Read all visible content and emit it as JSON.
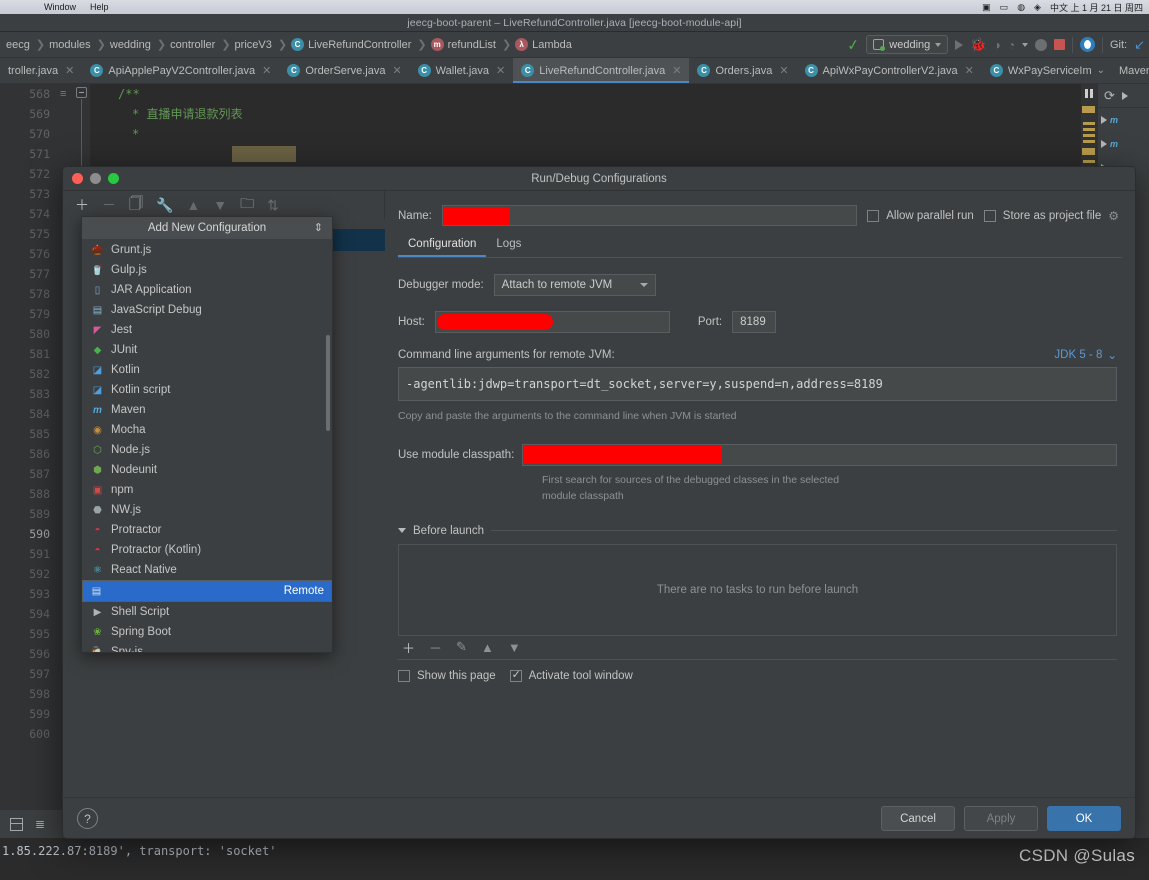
{
  "mac_menu": {
    "items": [
      "Window",
      "Help"
    ],
    "right_items": [
      "⌘",
      "▣",
      "◑",
      "☸",
      "♫",
      "◔",
      "⌫"
    ],
    "right_text": "中文 上 1 月 21 日 周四"
  },
  "ide": {
    "title": "jeecg-boot-parent – LiveRefundController.java [jeecg-boot-module-api]"
  },
  "breadcrumb": {
    "items": [
      {
        "label": "eecg",
        "badge": null
      },
      {
        "label": "modules",
        "badge": null
      },
      {
        "label": "wedding",
        "badge": null
      },
      {
        "label": "controller",
        "badge": null
      },
      {
        "label": "priceV3",
        "badge": null
      },
      {
        "label": "LiveRefundController",
        "badge": "C",
        "badge_kind": "c"
      },
      {
        "label": "refundList",
        "badge": "m",
        "badge_kind": "m"
      },
      {
        "label": "Lambda",
        "badge": "λ",
        "badge_kind": "l"
      }
    ]
  },
  "nav_toolbar": {
    "run_config": "wedding",
    "git_label": "Git:",
    "icons": [
      "checkmark-green-icon",
      "run-icon",
      "debug-icon",
      "coverage-icon",
      "profile-icon",
      "stop-icon",
      "idea-icon",
      "git-update-icon"
    ]
  },
  "editor_tabs": [
    {
      "label": "troller.java",
      "active": false
    },
    {
      "label": "ApiApplePayV2Controller.java",
      "active": false
    },
    {
      "label": "OrderServe.java",
      "active": false
    },
    {
      "label": "Wallet.java",
      "active": false
    },
    {
      "label": "LiveRefundController.java",
      "active": true
    },
    {
      "label": "Orders.java",
      "active": false
    },
    {
      "label": "ApiWxPayControllerV2.java",
      "active": false
    },
    {
      "label": "WxPayServiceIm",
      "active": false
    }
  ],
  "right_tool_label": "Maven",
  "editor": {
    "line_numbers": [
      "568",
      "569",
      "570",
      "571",
      "572",
      "573",
      "574",
      "575",
      "576",
      "577",
      "578",
      "579",
      "580",
      "581",
      "582",
      "583",
      "584",
      "585",
      "586",
      "587",
      "588",
      "589",
      "590",
      "591",
      "592",
      "593",
      "594",
      "595",
      "596",
      "597",
      "598",
      "599",
      "600"
    ],
    "current_line": "590",
    "code_lines": [
      "/**",
      "* 直播申请退款列表",
      "*"
    ]
  },
  "console": {
    "text": "1.85.222.87:8189', transport: 'socket'",
    "watermark": "CSDN @Sulas"
  },
  "dialog": {
    "title": "Run/Debug Configurations",
    "left_toolbar_icons": [
      "add-icon",
      "remove-icon",
      "copy-icon",
      "edit-templates-icon",
      "move-up-icon",
      "move-down-icon",
      "new-folder-icon",
      "sort-icon"
    ],
    "popup": {
      "header": "Add New Configuration",
      "items": [
        {
          "label": "Grunt.js",
          "icon": "grunt-icon"
        },
        {
          "label": "Gulp.js",
          "icon": "gulp-icon"
        },
        {
          "label": "JAR Application",
          "icon": "jar-icon"
        },
        {
          "label": "JavaScript Debug",
          "icon": "javascript-debug-icon"
        },
        {
          "label": "Jest",
          "icon": "jest-icon"
        },
        {
          "label": "JUnit",
          "icon": "junit-icon"
        },
        {
          "label": "Kotlin",
          "icon": "kotlin-icon"
        },
        {
          "label": "Kotlin script",
          "icon": "kotlin-script-icon"
        },
        {
          "label": "Maven",
          "icon": "maven-icon"
        },
        {
          "label": "Mocha",
          "icon": "mocha-icon"
        },
        {
          "label": "Node.js",
          "icon": "nodejs-icon"
        },
        {
          "label": "Nodeunit",
          "icon": "nodeunit-icon"
        },
        {
          "label": "npm",
          "icon": "npm-icon"
        },
        {
          "label": "NW.js",
          "icon": "nwjs-icon"
        },
        {
          "label": "Protractor",
          "icon": "protractor-icon"
        },
        {
          "label": "Protractor (Kotlin)",
          "icon": "protractor-kotlin-icon"
        },
        {
          "label": "React Native",
          "icon": "react-native-icon"
        },
        {
          "label": "Remote",
          "icon": "remote-icon",
          "selected": true
        },
        {
          "label": "Shell Script",
          "icon": "shell-script-icon"
        },
        {
          "label": "Spring Boot",
          "icon": "spring-boot-icon"
        },
        {
          "label": "Spy-js",
          "icon": "spy-js-icon"
        }
      ]
    },
    "name_label": "Name:",
    "name_value": "",
    "allow_parallel_run": "Allow parallel run",
    "store_as_project_file": "Store as project file",
    "tabs": [
      {
        "label": "Configuration",
        "active": true
      },
      {
        "label": "Logs",
        "active": false
      }
    ],
    "debugger_mode_label": "Debugger mode:",
    "debugger_mode_value": "Attach to remote JVM",
    "host_label": "Host:",
    "host_value": "",
    "port_label": "Port:",
    "port_value": "8189",
    "args_label": "Command line arguments for remote JVM:",
    "jdk_label": "JDK 5 - 8",
    "args_value": "-agentlib:jdwp=transport=dt_socket,server=y,suspend=n,address=8189",
    "args_hint": "Copy and paste the arguments to the command line when JVM is started",
    "module_classpath_label": "Use module classpath:",
    "module_classpath_value": "",
    "module_hint_line1": "First search for sources of the debugged classes in the selected",
    "module_hint_line2": "module classpath",
    "before_launch_label": "Before launch",
    "before_launch_empty": "There are no tasks to run before launch",
    "before_launch_toolbar": [
      "add-icon",
      "remove-icon",
      "edit-icon",
      "move-up-icon",
      "move-down-icon"
    ],
    "show_this_page": "Show this page",
    "activate_tool_window": "Activate tool window",
    "activate_tool_window_checked": true,
    "show_this_page_checked": false,
    "help_label": "?",
    "buttons": {
      "cancel": "Cancel",
      "apply": "Apply",
      "ok": "OK"
    }
  },
  "colors": {
    "accent_blue": "#3973ab",
    "selection_blue": "#2a6bc9",
    "redaction_red": "#fe0000",
    "link_blue": "#5e9ad6",
    "panel_bg": "#3c3f41",
    "editor_bg": "#2b2b2b",
    "comment_green": "#629755"
  }
}
